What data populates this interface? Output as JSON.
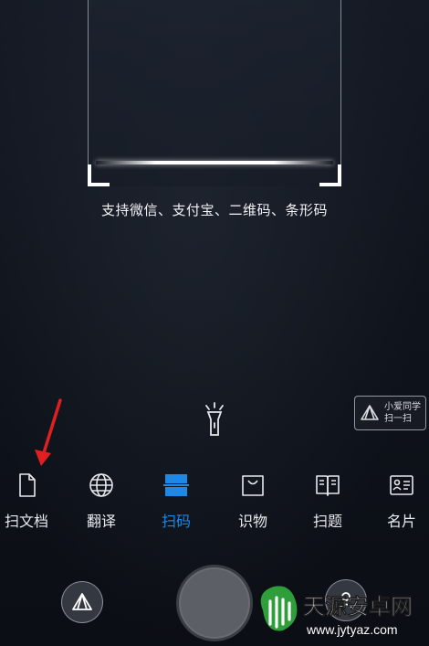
{
  "scanner": {
    "hint": "支持微信、支付宝、二维码、条形码"
  },
  "badge": {
    "line1": "小爱同学",
    "line2": "扫一扫"
  },
  "modes": [
    {
      "label": "扫文档",
      "icon": "document-icon",
      "active": false
    },
    {
      "label": "翻译",
      "icon": "globe-icon",
      "active": false
    },
    {
      "label": "扫码",
      "icon": "scan-code-icon",
      "active": true
    },
    {
      "label": "识物",
      "icon": "shopping-bag-icon",
      "active": false
    },
    {
      "label": "扫题",
      "icon": "open-book-icon",
      "active": false
    },
    {
      "label": "名片",
      "icon": "business-card-icon",
      "active": false
    }
  ],
  "watermark": {
    "name": "天源安卓网",
    "url": "www.jytyaz.com"
  },
  "colors": {
    "active": "#1e88e5",
    "annotation_arrow": "#e02020",
    "background": "#10141d"
  }
}
